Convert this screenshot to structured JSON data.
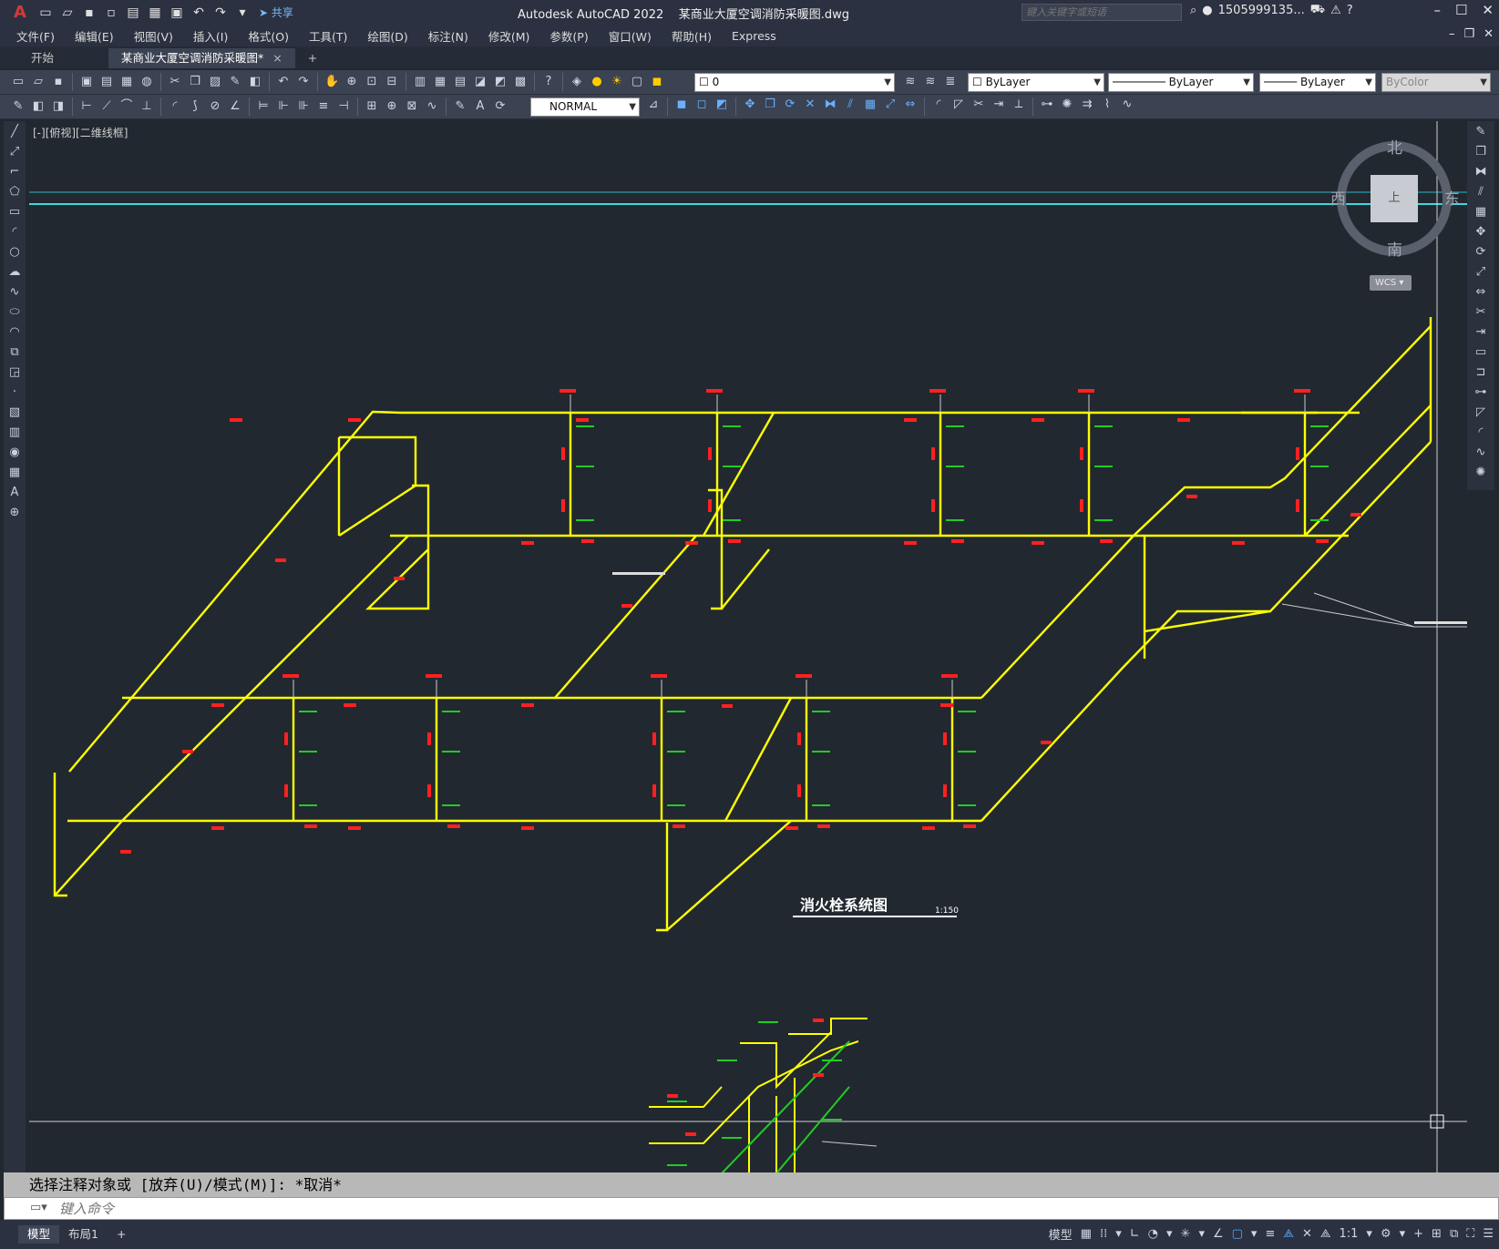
{
  "app": {
    "name": "Autodesk AutoCAD 2022",
    "file": "某商业大厦空调消防采暖图.dwg",
    "share_label": "共享",
    "search_placeholder": "键入关键字或短语",
    "user": "1505999135...",
    "logo": "A"
  },
  "menu": [
    "文件(F)",
    "编辑(E)",
    "视图(V)",
    "插入(I)",
    "格式(O)",
    "工具(T)",
    "绘图(D)",
    "标注(N)",
    "修改(M)",
    "参数(P)",
    "窗口(W)",
    "帮助(H)",
    "Express"
  ],
  "tabs": {
    "start": "开始",
    "doc": "某商业大厦空调消防采暖图*",
    "close": "×",
    "add": "+"
  },
  "properties": {
    "layer": "0",
    "color": "ByLayer",
    "linetype": "ByLayer",
    "lineweight": "ByLayer",
    "plotstyle": "ByColor",
    "dimstyle": "NORMAL"
  },
  "canvas": {
    "viewport_label": "[-][俯视][二维线框]",
    "drawing_title": "消火栓系统图",
    "drawing_scale": "1:150",
    "accent_pipe": "#ffff00",
    "accent_label": "#ff2020",
    "accent_dim": "#22cc22",
    "background": "#212830"
  },
  "viewcube": {
    "north": "北",
    "south": "南",
    "west": "西",
    "east": "东",
    "face": "上",
    "wcs": "WCS"
  },
  "command": {
    "history": "选择注释对象或 [放弃(U)/模式(M)]: *取消*",
    "placeholder": "键入命令"
  },
  "status": {
    "model_tab": "模型",
    "layout_tab": "布局1",
    "add_tab": "+",
    "model_button": "模型",
    "scale": "1:1"
  }
}
